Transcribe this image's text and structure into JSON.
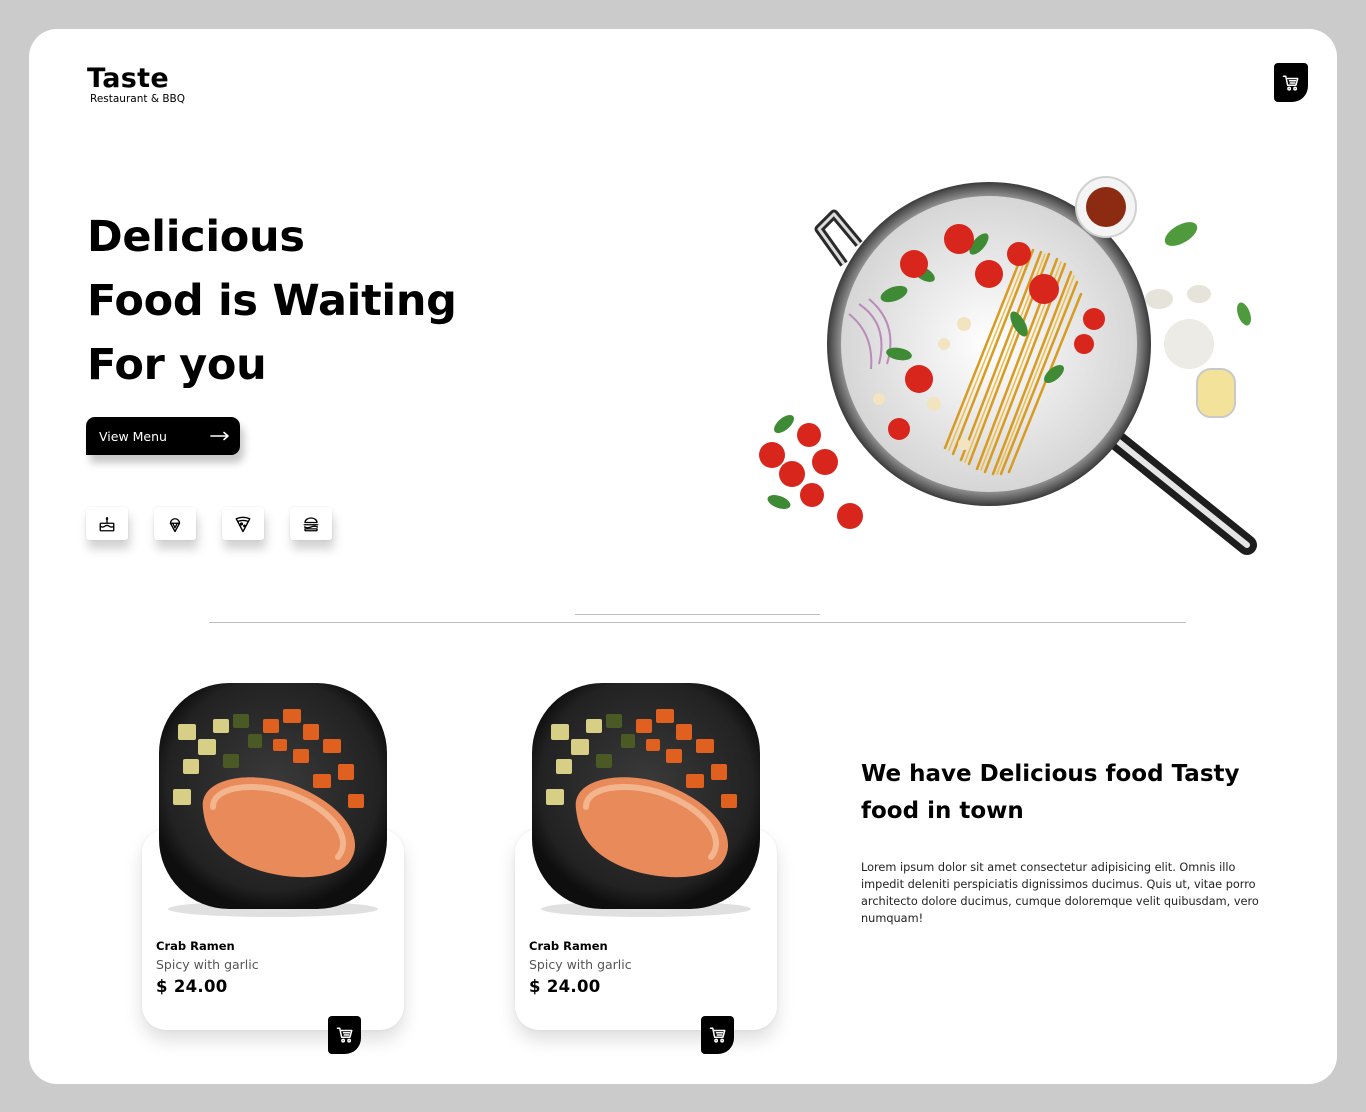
{
  "brand": {
    "name": "Taste",
    "subtitle": "Restaurant & BBQ"
  },
  "header": {
    "cart_icon": "cart-icon"
  },
  "hero": {
    "title_lines": [
      "Delicious",
      "Food is Waiting",
      "For you"
    ],
    "cta_label": "View Menu",
    "cta_icon": "arrow-right-icon",
    "image_desc": "pan-of-pasta"
  },
  "categories": [
    {
      "icon": "cake-icon"
    },
    {
      "icon": "ice-cream-icon"
    },
    {
      "icon": "pizza-icon"
    },
    {
      "icon": "burger-icon"
    }
  ],
  "products": [
    {
      "name": "Crab Ramen",
      "description": "Spicy with garlic",
      "price": "$ 24.00"
    },
    {
      "name": "Crab Ramen",
      "description": "Spicy with garlic",
      "price": "$ 24.00"
    }
  ],
  "about": {
    "title": "We have Delicious food Tasty food in town",
    "text": "Lorem ipsum dolor sit amet consectetur adipisicing elit. Omnis illo impedit deleniti perspiciatis dignissimos ducimus. Quis ut, vitae porro architecto dolore ducimus, cumque doloremque velit quibusdam, vero numquam!"
  },
  "colors": {
    "background": "#cbcbcb",
    "surface": "#ffffff",
    "accent": "#000000"
  }
}
